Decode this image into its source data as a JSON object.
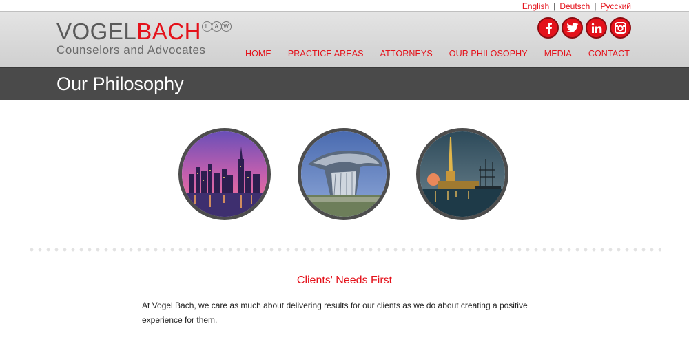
{
  "languages": [
    "English",
    "Deutsch",
    "Русский"
  ],
  "logo": {
    "part1": "VOGEL",
    "part2": "BACH",
    "badge": [
      "L",
      "A",
      "W"
    ],
    "tagline": "Counselors and Advocates"
  },
  "social": [
    {
      "name": "facebook",
      "icon": "facebook-icon"
    },
    {
      "name": "twitter",
      "icon": "twitter-icon"
    },
    {
      "name": "linkedin",
      "icon": "linkedin-icon"
    },
    {
      "name": "instagram",
      "icon": "instagram-icon"
    }
  ],
  "nav": [
    "HOME",
    "PRACTICE AREAS",
    "ATTORNEYS",
    "OUR PHILOSOPHY",
    "MEDIA",
    "CONTACT"
  ],
  "page_title": "Our Philosophy",
  "images": [
    {
      "name": "city-skyline-night-image"
    },
    {
      "name": "modern-building-image"
    },
    {
      "name": "cathedral-spire-night-image"
    }
  ],
  "section": {
    "title": "Clients' Needs First",
    "body": "At Vogel Bach, we care as much about delivering results for our clients as we do about creating a positive experience for them."
  },
  "colors": {
    "brand_red": "#e4121b",
    "title_band": "#4a4a4a",
    "header_bg": "#d8d8d8"
  }
}
